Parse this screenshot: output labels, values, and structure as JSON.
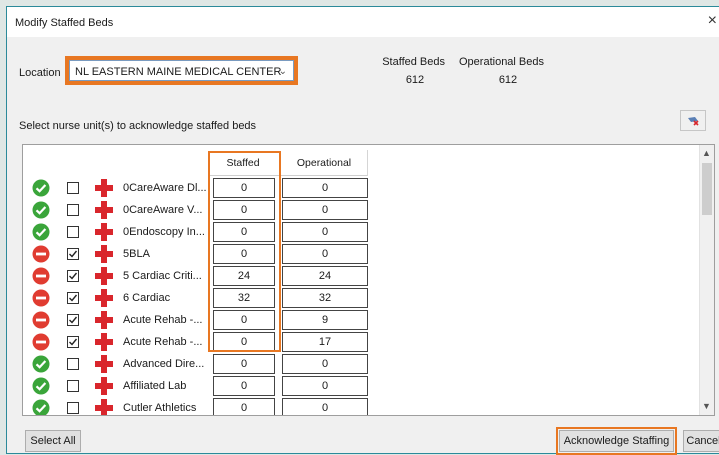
{
  "dialog": {
    "title": "Modify Staffed Beds",
    "close": "×"
  },
  "location": {
    "label": "Location",
    "value": "NL EASTERN MAINE MEDICAL CENTER"
  },
  "summary": {
    "staffed_label": "Staffed Beds",
    "staffed_value": "612",
    "operational_label": "Operational Beds",
    "operational_value": "612"
  },
  "prompt": "Select nurse unit(s) to acknowledge staffed beds",
  "grid": {
    "headers": {
      "staffed": "Staffed",
      "operational": "Operational"
    },
    "rows": [
      {
        "status": "ok",
        "checked": false,
        "name": "0CareAware Dl...",
        "staffed": "0",
        "operational": "0"
      },
      {
        "status": "ok",
        "checked": false,
        "name": "0CareAware V...",
        "staffed": "0",
        "operational": "0"
      },
      {
        "status": "ok",
        "checked": false,
        "name": "0Endoscopy In...",
        "staffed": "0",
        "operational": "0"
      },
      {
        "status": "stop",
        "checked": true,
        "name": "5BLA",
        "staffed": "0",
        "operational": "0"
      },
      {
        "status": "stop",
        "checked": true,
        "name": "5 Cardiac Criti...",
        "staffed": "24",
        "operational": "24"
      },
      {
        "status": "stop",
        "checked": true,
        "name": "6 Cardiac",
        "staffed": "32",
        "operational": "32"
      },
      {
        "status": "stop",
        "checked": true,
        "name": "Acute Rehab -...",
        "staffed": "0",
        "operational": "9"
      },
      {
        "status": "stop",
        "checked": true,
        "name": "Acute Rehab -...",
        "staffed": "0",
        "operational": "17"
      },
      {
        "status": "ok",
        "checked": false,
        "name": "Advanced Dire...",
        "staffed": "0",
        "operational": "0"
      },
      {
        "status": "ok",
        "checked": false,
        "name": "Affiliated Lab",
        "staffed": "0",
        "operational": "0"
      },
      {
        "status": "ok",
        "checked": false,
        "name": "Cutler Athletics",
        "staffed": "0",
        "operational": "0"
      }
    ]
  },
  "buttons": {
    "select_all": "Select All",
    "acknowledge": "Acknowledge Staffing",
    "cancel": "Cancel"
  },
  "colors": {
    "accent": "#e87722",
    "ok_green": "#3aa53a",
    "stop_red": "#e03c31",
    "cross_red": "#d9262c"
  }
}
